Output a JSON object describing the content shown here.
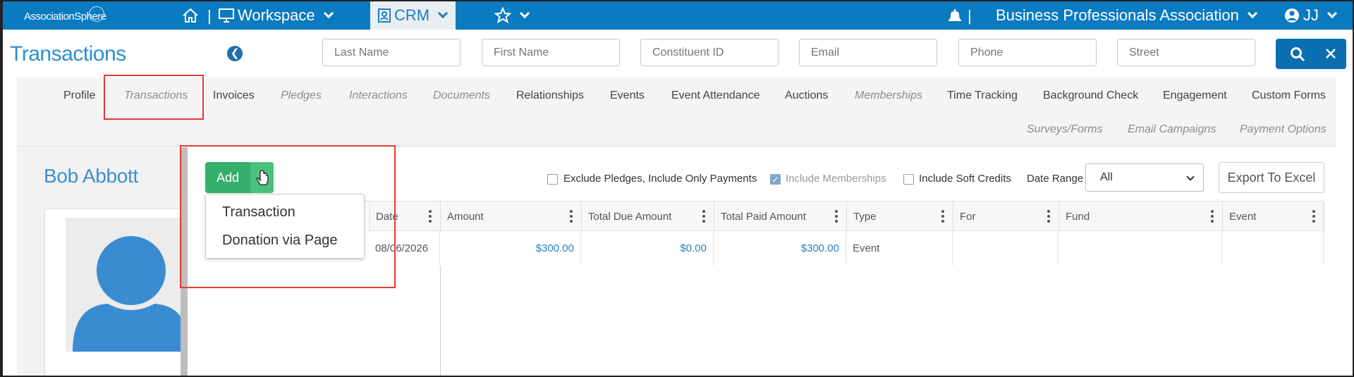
{
  "topnav": {
    "logo_text": "AssociationSphere",
    "workspace_label": "Workspace",
    "crm_label": "CRM",
    "org_name": "Business Professionals Association",
    "user_initials": "JJ",
    "separator": "|"
  },
  "page": {
    "title": "Transactions"
  },
  "search": {
    "last_name_placeholder": "Last Name",
    "first_name_placeholder": "First Name",
    "constituent_id_placeholder": "Constituent ID",
    "email_placeholder": "Email",
    "phone_placeholder": "Phone",
    "street_placeholder": "Street"
  },
  "tabs": {
    "row1": [
      "Profile",
      "Transactions",
      "Invoices",
      "Pledges",
      "Interactions",
      "Documents",
      "Relationships",
      "Events",
      "Event Attendance",
      "Auctions",
      "Memberships",
      "Time Tracking",
      "Background Check",
      "Engagement",
      "Custom Forms"
    ],
    "row2": [
      "Surveys/Forms",
      "Email Campaigns",
      "Payment Options"
    ]
  },
  "person": {
    "name": "Bob Abbott"
  },
  "actions": {
    "add_label": "Add",
    "menu": [
      "Transaction",
      "Donation via Page"
    ],
    "export_label": "Export To Excel"
  },
  "filters": {
    "exclude_pledges": "Exclude Pledges, Include Only Payments",
    "include_memberships": "Include Memberships",
    "include_soft_credits": "Include Soft Credits",
    "date_range_label": "Date Range",
    "date_range_value": "All"
  },
  "grid": {
    "columns": [
      "Date",
      "Amount",
      "Total Due Amount",
      "Total Paid Amount",
      "Type",
      "For",
      "Fund",
      "Event"
    ],
    "rows": [
      {
        "date": "08/06/2026",
        "amount": "$300.00",
        "total_due": "$0.00",
        "total_paid": "$300.00",
        "type": "Event",
        "for": "",
        "fund": "",
        "event": ""
      }
    ]
  },
  "colors": {
    "nav_blue": "#0a7ac1",
    "add_green": "#35b06c",
    "highlight_red": "#e53935",
    "link_blue": "#2a7fc0"
  }
}
